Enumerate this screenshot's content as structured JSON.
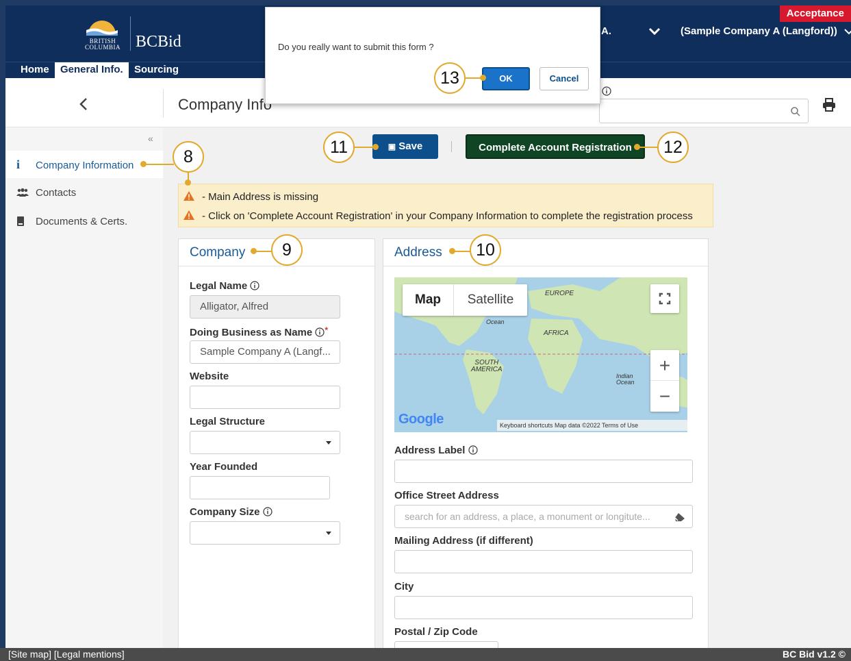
{
  "header": {
    "logo_text_1": "BRITISH",
    "logo_text_2": "COLUMBIA",
    "brand": "BCBid",
    "environment": "Acceptance",
    "user": "A.",
    "company": "(Sample Company A (Langford))"
  },
  "nav": {
    "home": "Home",
    "general": "General Info.",
    "sourcing": "Sourcing"
  },
  "title": {
    "page_title": "Company Info"
  },
  "sidebar": {
    "collapse": "«",
    "items": [
      {
        "label": "Company Information",
        "icon": "info-icon"
      },
      {
        "label": "Contacts",
        "icon": "users-icon"
      },
      {
        "label": "Documents & Certs.",
        "icon": "document-icon"
      }
    ]
  },
  "toolbar": {
    "save_label": "Save",
    "complete_label": "Complete Account Registration"
  },
  "alerts": [
    "- Main Address is missing",
    "- Click on 'Complete Account Registration' in your Company Information to complete the registration process"
  ],
  "company_card": {
    "title": "Company",
    "legal_name_label": "Legal Name",
    "legal_name_value": "Alligator, Alfred",
    "dba_label": "Doing Business as Name",
    "dba_required": "*",
    "dba_value": "Sample Company A (Langf...",
    "website_label": "Website",
    "legal_structure_label": "Legal Structure",
    "year_founded_label": "Year Founded",
    "company_size_label": "Company Size"
  },
  "address_card": {
    "title": "Address",
    "map": {
      "tab_map": "Map",
      "tab_satellite": "Satellite",
      "label_europe": "EUROPE",
      "label_africa": "AFRICA",
      "label_south_america_1": "SOUTH",
      "label_south_america_2": "AMERICA",
      "label_ocean": "Ocean",
      "label_indian_1": "Indian",
      "label_indian_2": "Ocean",
      "google": "Google",
      "footer": "Keyboard shortcuts   Map data ©2022   Terms of Use",
      "zoom_in": "+",
      "zoom_out": "−"
    },
    "address_label_label": "Address Label",
    "office_street_label": "Office Street Address",
    "office_street_placeholder": "search for an address, a place, a monument or longitute...",
    "mailing_label": "Mailing Address (if different)",
    "city_label": "City",
    "postal_label": "Postal / Zip Code"
  },
  "modal": {
    "message": "Do you really want to submit this form ?",
    "ok": "OK",
    "cancel": "Cancel"
  },
  "callouts": {
    "c8": "8",
    "c9": "9",
    "c10": "10",
    "c11": "11",
    "c12": "12",
    "c13": "13"
  },
  "footer": {
    "left": "[Site map] [Legal mentions]",
    "right": "BC Bid v1.2 ©"
  },
  "colors": {
    "header": "#0f2e5c",
    "accent_blue": "#1a5a96",
    "save": "#0d4f8b",
    "complete": "#0f4424",
    "callout": "#e2a92c",
    "alert": "#fbeecb",
    "acceptance": "#d8192d"
  }
}
